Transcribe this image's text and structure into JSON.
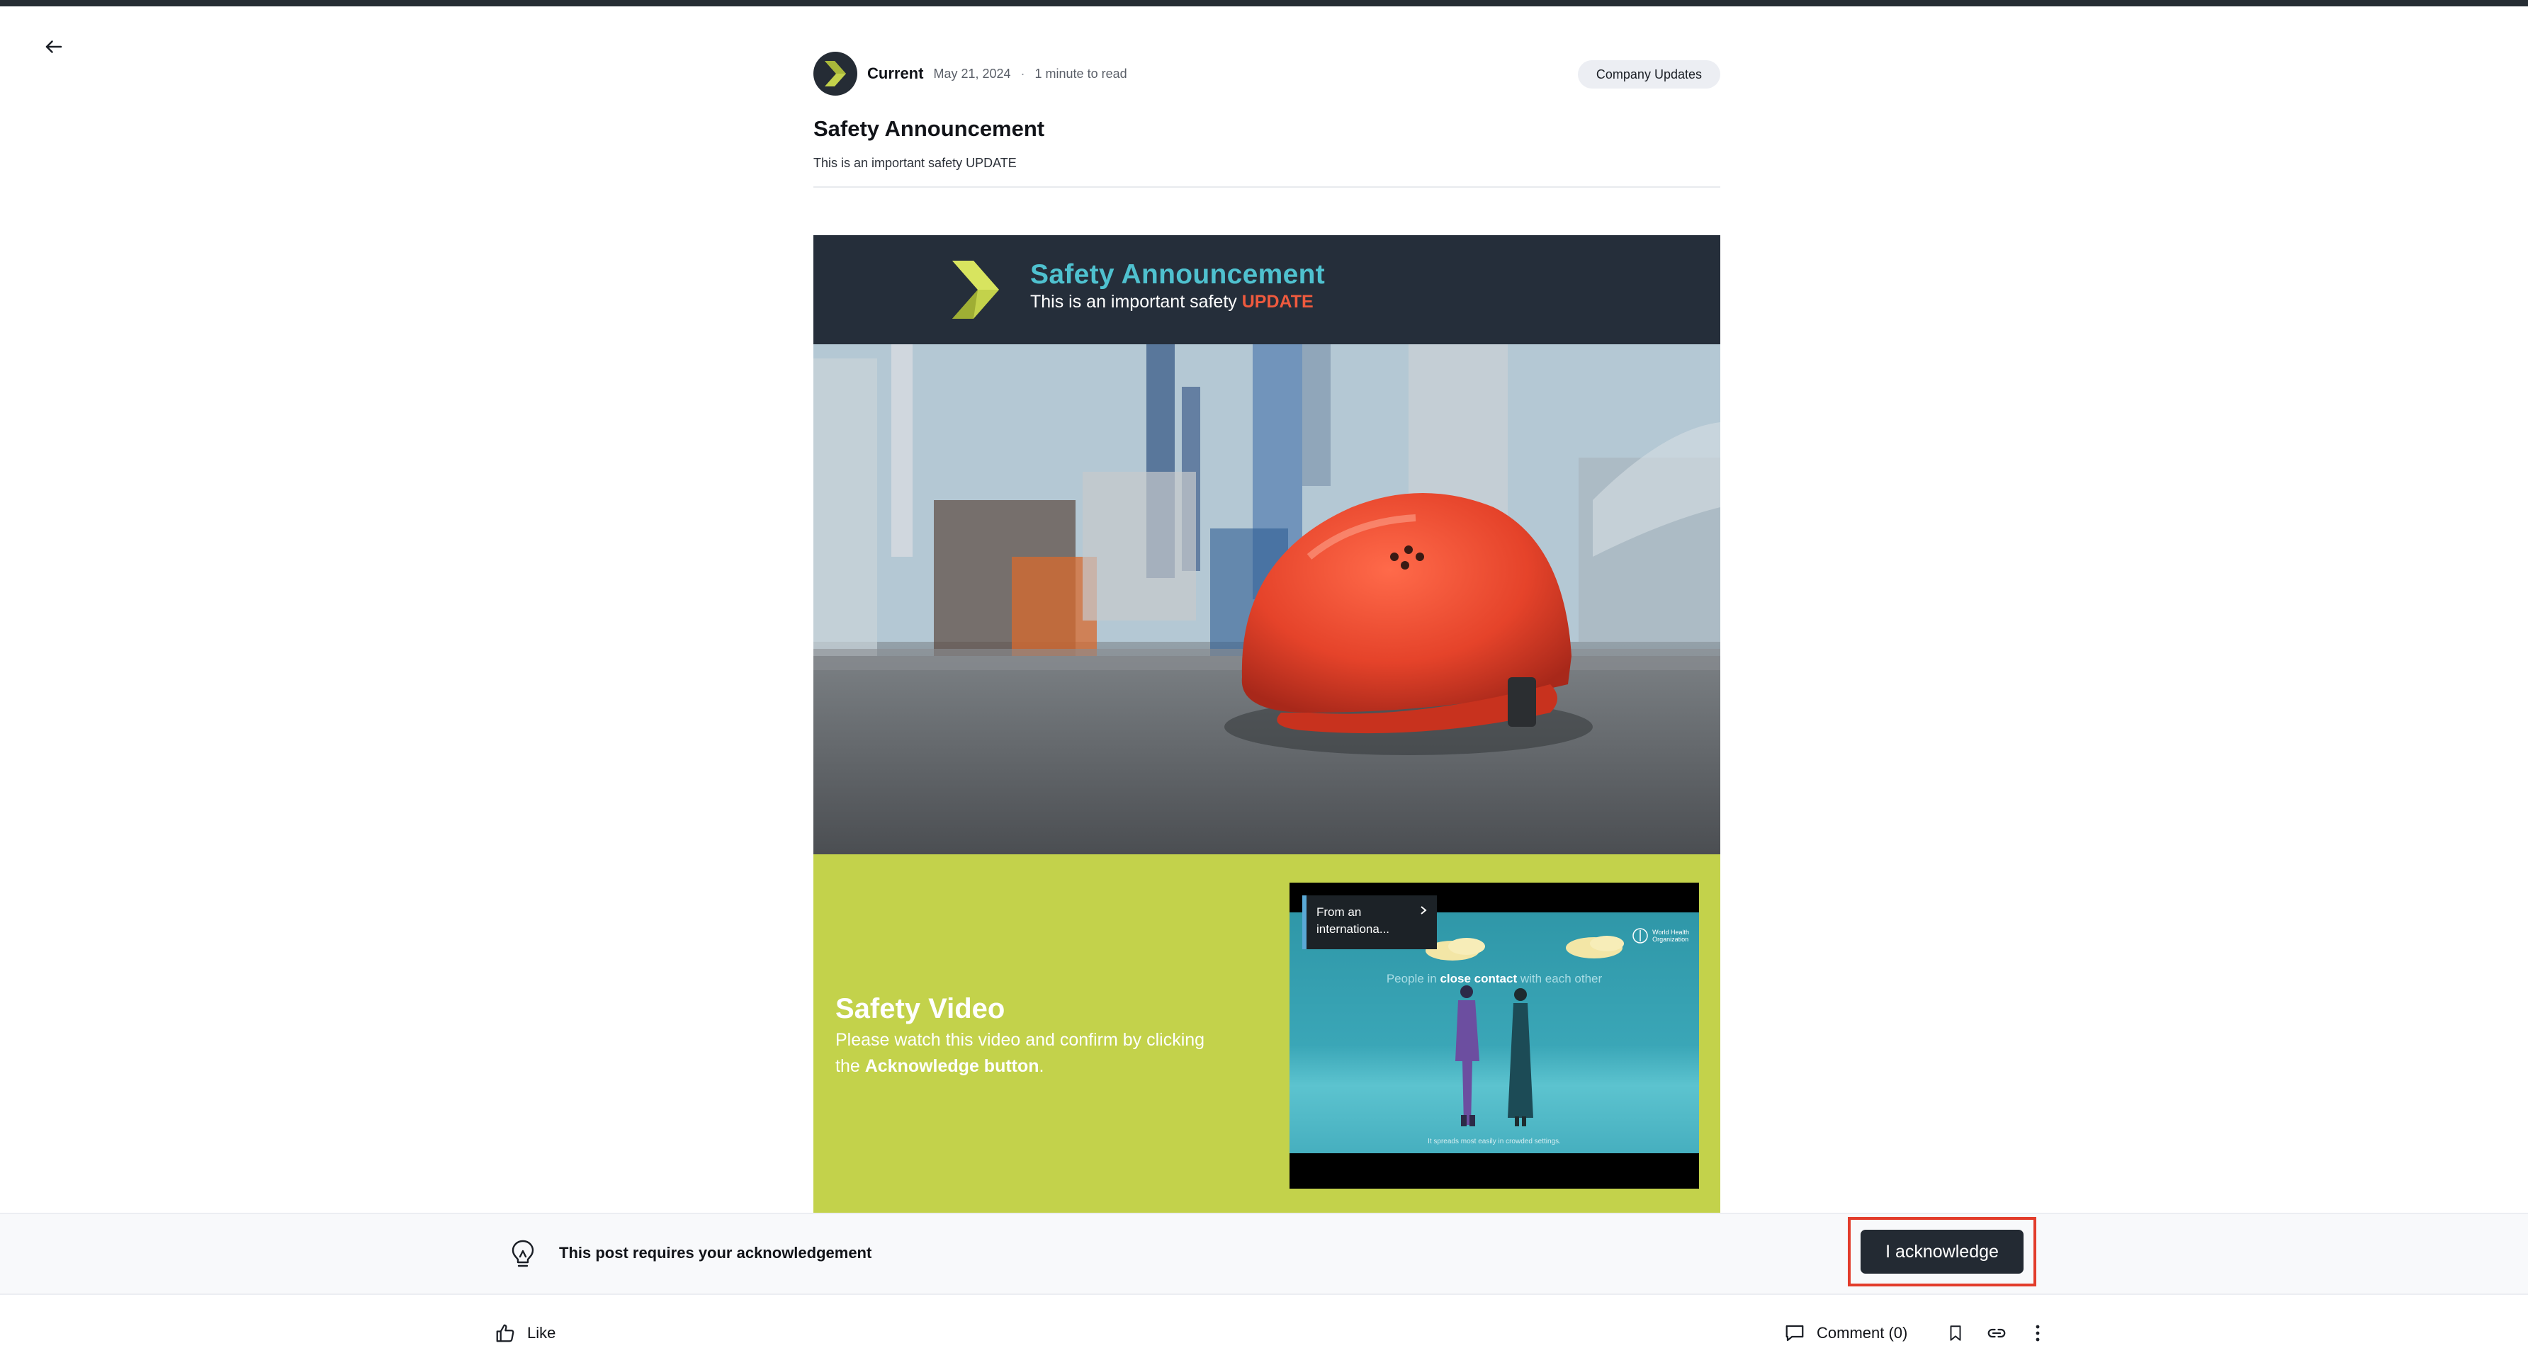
{
  "post": {
    "author": "Current",
    "date": "May 21, 2024",
    "separator": "·",
    "read_time": "1 minute to read",
    "category": "Company Updates",
    "title": "Safety Announcement",
    "subtitle": "This is an important safety UPDATE"
  },
  "banner": {
    "title": "Safety Announcement",
    "subtitle_prefix": "This is an important safety ",
    "subtitle_highlight": "UPDATE"
  },
  "video_section": {
    "heading": "Safety Video",
    "desc_prefix": "Please watch this video and confirm by clicking the ",
    "desc_bold": "Acknowledge button",
    "desc_suffix": ".",
    "video": {
      "chip_line1": "From an",
      "chip_line2": "internationa...",
      "caption_prefix": "People in ",
      "caption_bold": "close contact",
      "caption_suffix": " with each other",
      "bottom_caption": "It spreads most easily in crowded settings.",
      "logo_line1": "World Health",
      "logo_line2": "Organization"
    }
  },
  "acknowledgement": {
    "message": "This post requires your acknowledgement",
    "button_label": "I acknowledge"
  },
  "footer": {
    "like_label": "Like",
    "comment_label": "Comment (0)"
  },
  "colors": {
    "banner_bg": "#252e3a",
    "banner_title": "#4fc1cf",
    "update_highlight": "#ef5a3e",
    "video_section_bg": "#c3d24b",
    "primary_button": "#232a33",
    "annotation_highlight": "#e23c2b"
  }
}
